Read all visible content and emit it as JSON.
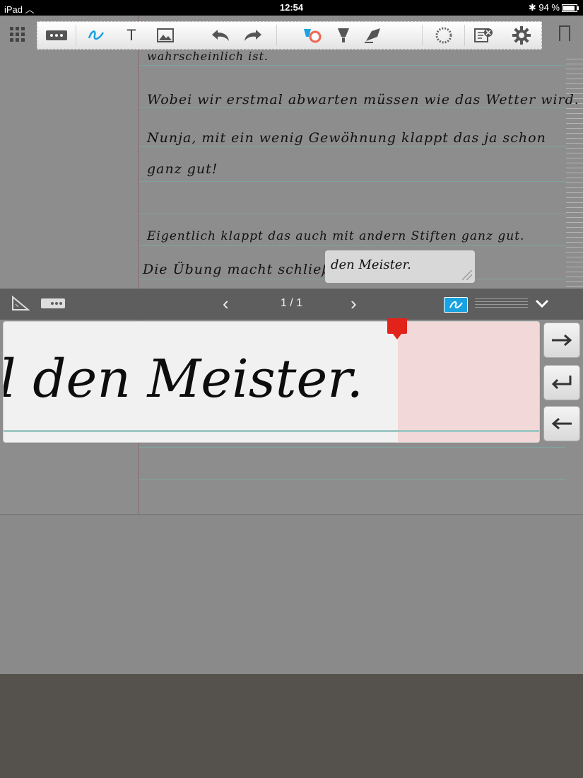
{
  "status": {
    "device": "iPad",
    "time": "12:54",
    "battery": "94 %"
  },
  "handwriting_lines": [
    "wahrscheinlich ist.",
    "Wobei wir erstmal abwarten müssen wie das Wetter wird.",
    "Nunja, mit ein wenig Gewöhnung klappt das ja schon",
    "ganz gut!",
    "Eigentlich klappt das auch mit andern Stiften ganz gut.",
    "Die Übung macht schließlich"
  ],
  "edit_box_text": "den Meister.",
  "writing_text": "l den Meister.",
  "page_indicator": "1 / 1",
  "toolbar": {
    "text_tool": "T"
  },
  "icons": {
    "grid": "grid-icon",
    "keyboard": "keyboard-icon",
    "pen": "pen-icon",
    "text": "text-icon",
    "image": "image-icon",
    "undo": "undo-icon",
    "redo": "redo-icon",
    "color": "color-picker-icon",
    "highlighter": "highlighter-icon",
    "eraser": "eraser-icon",
    "lasso": "lasso-icon",
    "clear": "clear-page-icon",
    "settings": "gear-icon",
    "bookmark": "bookmark-icon"
  },
  "colors": {
    "accent": "#1aa3e0",
    "marker": "#e2231a"
  }
}
